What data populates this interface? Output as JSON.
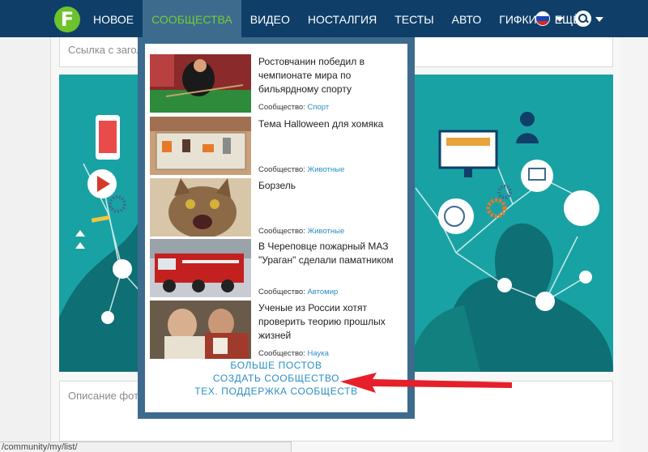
{
  "nav": {
    "items": [
      "НОВОЕ",
      "СООБЩЕСТВА",
      "ВИДЕО",
      "НОСТАЛГИЯ",
      "ТЕСТЫ",
      "АВТО",
      "ГИФКИ",
      "ЕЩЁ"
    ],
    "active_index": 1,
    "logo_letter": "F"
  },
  "form": {
    "link_placeholder": "Ссылка с загол",
    "description_placeholder": "Описание фот"
  },
  "dropdown": {
    "posts": [
      {
        "title": "Ростовчанин победил в чемпионате мира по бильярдному спорту",
        "meta_prefix": "Сообщество:",
        "category": "Спорт"
      },
      {
        "title": "Тема Halloween для хомяка",
        "meta_prefix": "Сообщество:",
        "category": "Животные"
      },
      {
        "title": "Борзель",
        "meta_prefix": "Сообщество:",
        "category": "Животные"
      },
      {
        "title": "В Череповце пожарный МАЗ \"Ураган\" сделали паматником",
        "meta_prefix": "Сообщество:",
        "category": "Автомир"
      },
      {
        "title": "Ученые из России хотят проверить теорию прошлых жизней",
        "meta_prefix": "Сообщество:",
        "category": "Наука"
      }
    ],
    "more_posts": "БОЛЬШЕ ПОСТОВ",
    "create_community": "СОЗДАТЬ СООБЩЕСТВО",
    "support": "ТЕХ. ПОДДЕРЖКА СООБЩЕСТВ"
  },
  "status_url": "/community/my/list/",
  "colors": {
    "nav_bg": "#0f3f68",
    "active_bg": "#3d6b8e",
    "active_text": "#74cd34",
    "link": "#2a8fc6",
    "arrow": "#e5202a",
    "hero": "#19a2a4"
  },
  "icons": [
    "fishki-logo-icon",
    "russian-flag-icon",
    "search-icon",
    "red-arrow-annotation"
  ]
}
